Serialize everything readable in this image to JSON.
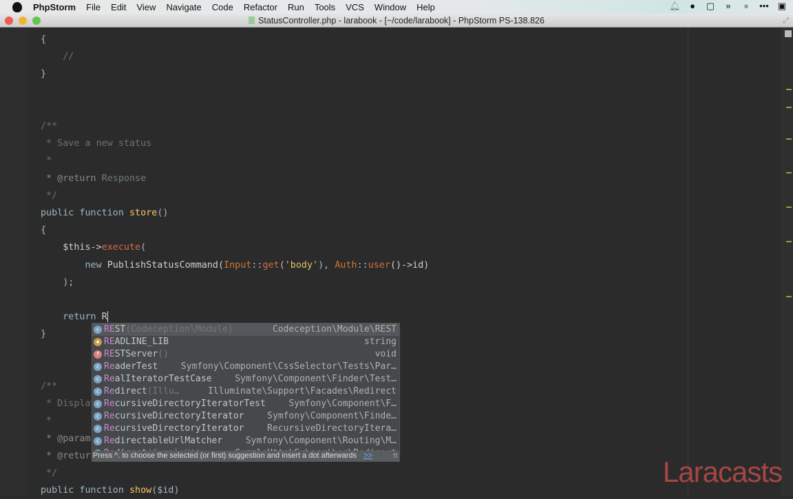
{
  "menubar": {
    "app": "PhpStorm",
    "items": [
      "File",
      "Edit",
      "View",
      "Navigate",
      "Code",
      "Refactor",
      "Run",
      "Tools",
      "VCS",
      "Window",
      "Help"
    ]
  },
  "window": {
    "title": "StatusController.php - larabook - [~/code/larabook] - PhpStorm PS-138.826"
  },
  "code": [
    [
      {
        "t": "{",
        "c": ""
      }
    ],
    [
      {
        "t": "    //",
        "c": "cm"
      }
    ],
    [
      {
        "t": "}",
        "c": ""
      }
    ],
    [],
    [],
    [
      {
        "t": "/**",
        "c": "cm"
      }
    ],
    [
      {
        "t": " * Save a new status",
        "c": "cm"
      }
    ],
    [
      {
        "t": " *",
        "c": "cm"
      }
    ],
    [
      {
        "t": " * @return",
        "c": "tag"
      },
      {
        "t": " Response",
        "c": "doc"
      }
    ],
    [
      {
        "t": " */",
        "c": "cm"
      }
    ],
    [
      {
        "t": "public function ",
        "c": "kw"
      },
      {
        "t": "store",
        "c": "fn"
      },
      {
        "t": "()",
        "c": ""
      }
    ],
    [
      {
        "t": "{",
        "c": ""
      }
    ],
    [
      {
        "t": "    $this->",
        "c": "var"
      },
      {
        "t": "execute",
        "c": "mt"
      },
      {
        "t": "(",
        "c": ""
      }
    ],
    [
      {
        "t": "        new ",
        "c": "kw"
      },
      {
        "t": "PublishStatusCommand(",
        "c": "var"
      },
      {
        "t": "Input",
        "c": "cls"
      },
      {
        "t": "::",
        "c": ""
      },
      {
        "t": "get",
        "c": "mt"
      },
      {
        "t": "(",
        "c": ""
      },
      {
        "t": "'body'",
        "c": "str"
      },
      {
        "t": "), ",
        "c": ""
      },
      {
        "t": "Auth",
        "c": "cls"
      },
      {
        "t": "::",
        "c": ""
      },
      {
        "t": "user",
        "c": "mt"
      },
      {
        "t": "()->id)",
        "c": "var"
      }
    ],
    [
      {
        "t": "    );",
        "c": ""
      }
    ],
    [],
    [
      {
        "t": "    return ",
        "c": "kw"
      },
      {
        "t": "R",
        "c": "var"
      }
    ],
    [
      {
        "t": "}",
        "c": ""
      }
    ],
    [],
    [],
    [
      {
        "t": "/**",
        "c": "cm"
      }
    ],
    [
      {
        "t": " * Display",
        "c": "cm"
      }
    ],
    [
      {
        "t": " *",
        "c": "cm"
      }
    ],
    [
      {
        "t": " * @param",
        "c": "tag"
      }
    ],
    [
      {
        "t": " * @return",
        "c": "tag"
      }
    ],
    [
      {
        "t": " */",
        "c": "cm"
      }
    ],
    [
      {
        "t": "public function ",
        "c": "kw"
      },
      {
        "t": "show",
        "c": "fn"
      },
      {
        "t": "($id)",
        "c": ""
      }
    ]
  ],
  "completion": {
    "items": [
      {
        "match": "RE",
        "rest": "ST",
        "hint": " (Codeception\\Module)",
        "type": "Codeception\\Module\\REST",
        "icon": "class",
        "selected": true
      },
      {
        "match": "RE",
        "rest": "ADLINE_LIB",
        "hint": "",
        "type": "string",
        "icon": "const"
      },
      {
        "match": "RE",
        "rest": "STServer",
        "hint": "()",
        "type": "void",
        "icon": "func"
      },
      {
        "match": "Re",
        "rest": "aderTest",
        "hint": "",
        "type": "Symfony\\Component\\CssSelector\\Tests\\Par…",
        "icon": "class"
      },
      {
        "match": "Re",
        "rest": "alIteratorTestCase",
        "hint": "",
        "type": "Symfony\\Component\\Finder\\Test…",
        "icon": "class"
      },
      {
        "match": "Re",
        "rest": "direct",
        "hint": " (Illu…",
        "type": "Illuminate\\Support\\Facades\\Redirect",
        "icon": "class"
      },
      {
        "match": "Re",
        "rest": "cursiveDirectoryIteratorTest",
        "hint": "",
        "type": "Symfony\\Component\\F…",
        "icon": "class"
      },
      {
        "match": "Re",
        "rest": "cursiveDirectoryIterator",
        "hint": "",
        "type": "Symfony\\Component\\Finde…",
        "icon": "class"
      },
      {
        "match": "Re",
        "rest": "cursiveDirectoryIterator",
        "hint": "",
        "type": "RecursiveDirectoryItera…",
        "icon": "class"
      },
      {
        "match": "Re",
        "rest": "directableUrlMatcher",
        "hint": "",
        "type": "Symfony\\Component\\Routing\\M…",
        "icon": "class"
      },
      {
        "match": "Re",
        "rest": "direct",
        "hint": " (GuzzleHtt…",
        "type": "GuzzleHttp\\Subscriber\\Redirect",
        "icon": "class"
      }
    ],
    "footer": "Press ^. to choose the selected (or first) suggestion and insert a dot afterwards",
    "footer_link": ">>",
    "pi": "π"
  },
  "watermark": "Laracasts"
}
